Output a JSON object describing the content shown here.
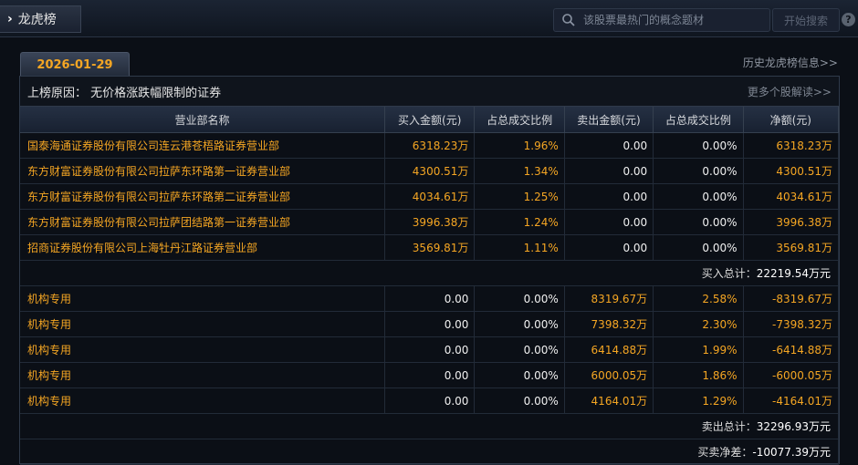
{
  "header": {
    "tab_label": "龙虎榜",
    "search_placeholder": "该股票最热门的概念题材",
    "search_button": "开始搜索",
    "help": "?"
  },
  "date_tab": "2026-01-29",
  "history_link": "历史龙虎榜信息>>",
  "reason": {
    "label": "上榜原因：",
    "text": "无价格涨跌幅限制的证券",
    "more_link": "更多个股解读>>"
  },
  "table": {
    "columns": [
      "营业部名称",
      "买入金额(元)",
      "占总成交比例",
      "卖出金额(元)",
      "占总成交比例",
      "净额(元)"
    ],
    "buy_rows": [
      {
        "name": "国泰海通证券股份有限公司连云港苍梧路证券营业部",
        "buy": "6318.23万",
        "buy_pct": "1.96%",
        "sell": "0.00",
        "sell_pct": "0.00%",
        "net": "6318.23万"
      },
      {
        "name": "东方财富证券股份有限公司拉萨东环路第一证券营业部",
        "buy": "4300.51万",
        "buy_pct": "1.34%",
        "sell": "0.00",
        "sell_pct": "0.00%",
        "net": "4300.51万"
      },
      {
        "name": "东方财富证券股份有限公司拉萨东环路第二证券营业部",
        "buy": "4034.61万",
        "buy_pct": "1.25%",
        "sell": "0.00",
        "sell_pct": "0.00%",
        "net": "4034.61万"
      },
      {
        "name": "东方财富证券股份有限公司拉萨团结路第一证券营业部",
        "buy": "3996.38万",
        "buy_pct": "1.24%",
        "sell": "0.00",
        "sell_pct": "0.00%",
        "net": "3996.38万"
      },
      {
        "name": "招商证券股份有限公司上海牡丹江路证券营业部",
        "buy": "3569.81万",
        "buy_pct": "1.11%",
        "sell": "0.00",
        "sell_pct": "0.00%",
        "net": "3569.81万"
      }
    ],
    "buy_total_label": "买入总计：",
    "buy_total_value": "22219.54万元",
    "sell_rows": [
      {
        "name": "机构专用",
        "buy": "0.00",
        "buy_pct": "0.00%",
        "sell": "8319.67万",
        "sell_pct": "2.58%",
        "net": "-8319.67万"
      },
      {
        "name": "机构专用",
        "buy": "0.00",
        "buy_pct": "0.00%",
        "sell": "7398.32万",
        "sell_pct": "2.30%",
        "net": "-7398.32万"
      },
      {
        "name": "机构专用",
        "buy": "0.00",
        "buy_pct": "0.00%",
        "sell": "6414.88万",
        "sell_pct": "1.99%",
        "net": "-6414.88万"
      },
      {
        "name": "机构专用",
        "buy": "0.00",
        "buy_pct": "0.00%",
        "sell": "6000.05万",
        "sell_pct": "1.86%",
        "net": "-6000.05万"
      },
      {
        "name": "机构专用",
        "buy": "0.00",
        "buy_pct": "0.00%",
        "sell": "4164.01万",
        "sell_pct": "1.29%",
        "net": "-4164.01万"
      }
    ],
    "sell_total_label": "卖出总计：",
    "sell_total_value": "32296.93万元",
    "net_label": "买卖净差：",
    "net_value": "-10077.39万元"
  }
}
